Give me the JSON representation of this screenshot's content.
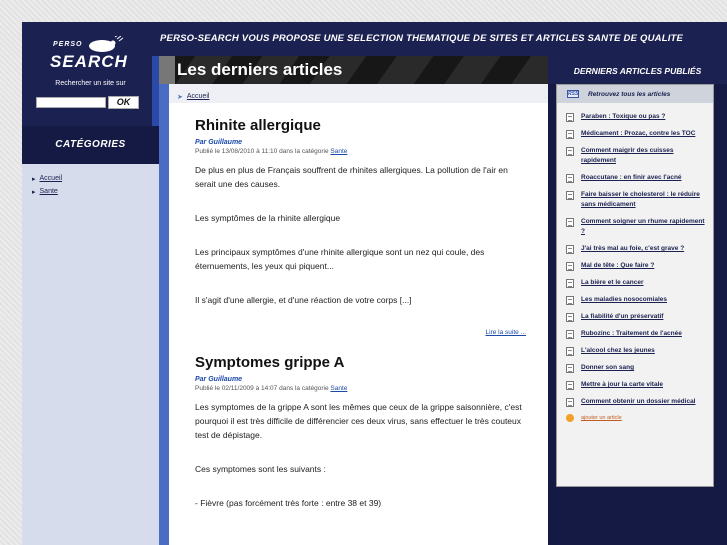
{
  "banner": {
    "tagline": "PERSO-SEARCH VOUS PROPOSE UNE SELECTION THEMATIQUE DE SITES ET ARTICLES SANTE DE QUALITE"
  },
  "logo": {
    "top": "PERSO",
    "main": "SEARCH"
  },
  "search": {
    "label": "Rechercher un site sur",
    "value": "",
    "button": "OK"
  },
  "categories": {
    "title": "CATÉGORIES",
    "items": [
      {
        "label": "Accueil"
      },
      {
        "label": "Sante"
      }
    ]
  },
  "main": {
    "title": "Les derniers articles",
    "breadcrumb": "Accueil",
    "articles": [
      {
        "title": "Rhinite allergique",
        "author": "Par Guillaume",
        "meta_prefix": "Publié le 13/08/2010 à 11:10 dans la catégorie",
        "category": "Sante",
        "paragraphs": [
          "De plus en plus de Français souffrent de rhinites allergiques. La pollution de l'air en serait une des causes.",
          "Les symptômes de la rhinite allergique",
          "Les principaux symptômes d'une rhinite allergique sont un nez qui coule, des éternuements, les yeux qui piquent...",
          "Il s'agit d'une allergie, et d'une réaction de votre corps [...]"
        ],
        "read_more": "Lire la suite ..."
      },
      {
        "title": "Symptomes grippe A",
        "author": "Par Guillaume",
        "meta_prefix": "Publié le 02/11/2009 à 14:07 dans la catégorie",
        "category": "Sante",
        "paragraphs": [
          "Les symptomes de la grippe A sont les mêmes que ceux de la grippe saisonnière, c'est pourquoi il est très difficile de différencier ces deux virus, sans effectuer le très couteux test de dépistage.",
          "Ces symptomes sont les suivants :",
          "- Fièvre (pas forcément très forte : entre 38 et 39)"
        ]
      }
    ]
  },
  "right": {
    "title": "DERNIERS ARTICLES PUBLIÉS",
    "all_link": "Retrouvez tous les articles",
    "posts": [
      "Paraben : Toxique ou pas ?",
      "Médicament : Prozac, contre les TOC",
      "Comment maigrir des cuisses rapidement",
      "Roaccutane : en finir avec l'acné",
      "Faire baisser le cholesterol : le réduire sans médicament",
      "Comment soigner un rhume rapidement ?",
      "J'ai très mal au foie, c'est grave ?",
      "Mal de tête : Que faire ?",
      "La bière et le cancer",
      "Les maladies nosocomiales",
      "La fiabilité d'un préservatif",
      "Rubozinc : Traitement de l'acnée",
      "L'alcool chez les jeunes",
      "Donner son sang",
      "Mettre à jour la carte vitale",
      "Comment obtenir un dossier médical"
    ],
    "add_favorite": "ajouter un article"
  },
  "colors": {
    "navy": "#1b2150",
    "link": "#1b4aa8",
    "accent_blue": "#4b6cc3"
  }
}
